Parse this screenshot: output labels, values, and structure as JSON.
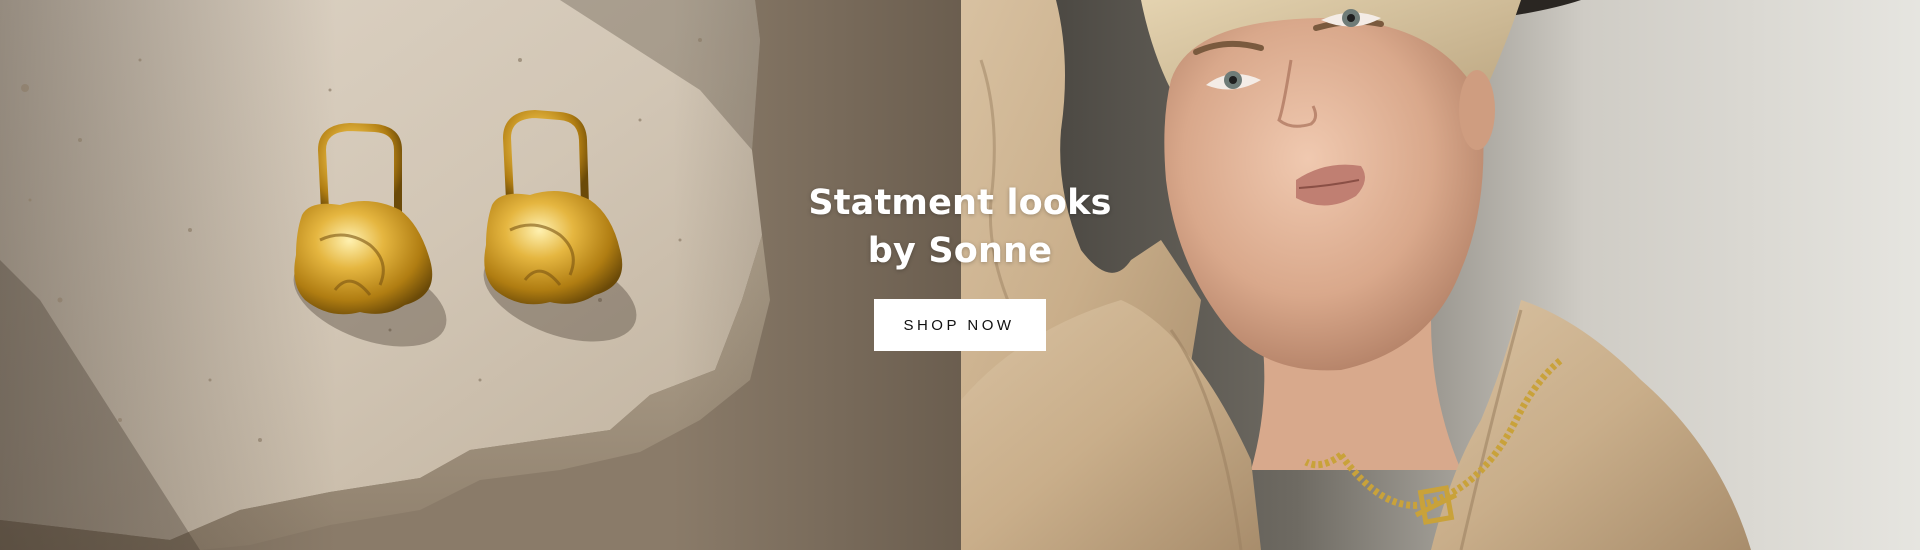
{
  "hero": {
    "headline_line1": "Statment looks",
    "headline_line2": "by Sonne",
    "cta_label": "SHOP NOW",
    "left_image": "earrings-on-stone-image",
    "right_image": "model-with-necklace-image"
  },
  "colors": {
    "headline_text": "#ffffff",
    "button_bg": "#ffffff",
    "button_text": "#111111",
    "gold": "#c9a23a"
  }
}
